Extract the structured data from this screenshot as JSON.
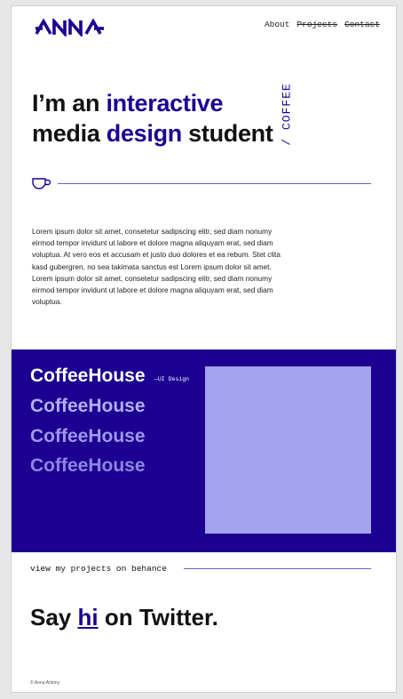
{
  "brand": {
    "logo_text": "ANNA",
    "accent_color": "#1c0091"
  },
  "nav": {
    "about": "About",
    "projects": "Projects",
    "contact": "Contact"
  },
  "hero": {
    "line1_pre": "I’m an ",
    "line1_accent": "interactive",
    "line2_pre": "media ",
    "line2_accent": "design",
    "line2_post": " student",
    "vertical_tag": "/ COFFEE"
  },
  "intro": {
    "icon": "coffee-cup-icon",
    "text": "Lorem ipsum dolor sit amet, consetetur sadipscing elitr, sed diam nonumy eirmod tempor invidunt ut labore et dolore magna aliquyam erat, sed diam voluptua. At vero eos et accusam et justo duo dolores et ea rebum. Stet clita kasd gubergren, no sea takimata sanctus est Lorem ipsum dolor sit amet. Lorem ipsum dolor sit amet, consetetur sadipscing elitr, sed diam nonumy eirmod tempor invidunt ut labore et dolore magna aliquyam erat, sed diam voluptua."
  },
  "projects": {
    "items": [
      {
        "label": "CoffeeHouse"
      },
      {
        "label": "CoffeeHouse"
      },
      {
        "label": "CoffeeHouse"
      },
      {
        "label": "CoffeeHouse"
      }
    ],
    "active_tag": "—UI Design",
    "band_color": "#1c0091",
    "preview_color": "#a4a3ee"
  },
  "behance": {
    "label": "view my projects on behance"
  },
  "twitter": {
    "pre": "Say ",
    "link": "hi",
    "post": " on Twitter."
  },
  "footer": {
    "copyright": "© Anna Antony"
  }
}
